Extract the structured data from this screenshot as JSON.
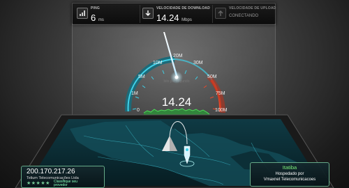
{
  "stats": {
    "ping": {
      "label": "PING",
      "value": "6",
      "unit": "ms"
    },
    "download": {
      "label": "VELOCIDADE DE DOWNLOAD",
      "value": "14.24",
      "unit": "Mbps"
    },
    "upload": {
      "label": "VELOCIDADE DE UPLOAD",
      "status": "CONECTANDO"
    }
  },
  "gauge": {
    "scale_labels": [
      "0",
      "1M",
      "5M",
      "10M",
      "20M",
      "30M",
      "50M",
      "75M",
      "100M"
    ],
    "center_caption": "bits por segundo",
    "readout": "14.24",
    "current_value": 14.24
  },
  "client": {
    "ip": "200.170.217.26",
    "isp": "Telium Telecomunicações Ltda",
    "rating_stars": "★★★★★",
    "rating_text_1": "Classifique seu",
    "rating_text_2": "provedor"
  },
  "server": {
    "city": "Itatiba",
    "hosted_by": "Hospedado por",
    "provider": "Vmaxnet Telecomunicacoes"
  },
  "colors": {
    "accent_cyan": "#3fd0e8",
    "accent_red": "#e84a2c",
    "graph_green": "#4fdc5a",
    "server_city": "#7cf07c"
  }
}
